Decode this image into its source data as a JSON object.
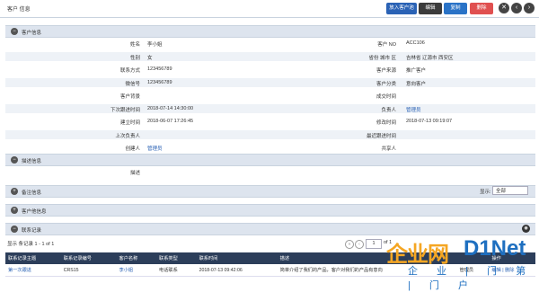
{
  "header": {
    "title": "客户 信息",
    "buttons": {
      "to_pool": "放入客户池",
      "edit": "编辑",
      "copy": "复制",
      "delete": "删除"
    },
    "circle_buttons": [
      "x",
      "<",
      ">"
    ]
  },
  "sections": {
    "customer_info": "客户信息",
    "description_info": "描述信息",
    "remark_info": "备注信息",
    "customer_other": "客户他信息",
    "contact_record": "联系记录"
  },
  "fields": [
    {
      "label": "姓名",
      "value": "李小姐",
      "label2": "客户 NO",
      "value2": "ACC106"
    },
    {
      "label": "性别",
      "value": "女",
      "label2": "省份 城市 区",
      "value2": "吉林省 辽源市 西安区"
    },
    {
      "label": "联系方式",
      "value": "123456789",
      "label2": "客户来源",
      "value2": "推广客户"
    },
    {
      "label": "微信号",
      "value": "123456789",
      "label2": "客户分类",
      "value2": "意向客户"
    },
    {
      "label": "客户背景",
      "value": "",
      "label2": "成交时间",
      "value2": ""
    },
    {
      "label": "下次跟进时间",
      "value": "2018-07-14 14:30:00",
      "label2": "负责人",
      "value2": "管理员"
    },
    {
      "label": "建立时间",
      "value": "2018-06-07 17:26:45",
      "label2": "修改时间",
      "value2": "2018-07-13 09:19:07"
    },
    {
      "label": "上次负责人",
      "value": "",
      "label2": "最近跟进时间",
      "value2": ""
    },
    {
      "label": "创建人",
      "value": "管理员",
      "label2": "共享人",
      "value2": ""
    }
  ],
  "description": {
    "label": "描述",
    "value": ""
  },
  "remark": {
    "display_label": "显示:",
    "display_value": "全部"
  },
  "pager": {
    "summary": "显示 条记录 1 - 1 of 1",
    "page": "1",
    "of": "of 1"
  },
  "table": {
    "headers": [
      "联系记录主题",
      "联系记录编号",
      "客户名称",
      "联系类型",
      "联系时间",
      "描述",
      "",
      "操作"
    ],
    "rows": [
      [
        "第一次跟进",
        "CRS15",
        "李小姐",
        "电话联系",
        "2018-07-13 09:42:06",
        "简单介绍了我们的产品，客户对我们的产品有意向",
        "管理员",
        "编辑 | 删除"
      ]
    ]
  },
  "watermark": {
    "brand_a": "企业网",
    "brand_b": "D1Net",
    "slogan": "企 业 | 门 第 | 门 户"
  },
  "colors": {
    "primary": "#2a62b5",
    "danger": "#e05050",
    "header_dark": "#2c3e5a",
    "section_bg": "#dde4ee"
  }
}
